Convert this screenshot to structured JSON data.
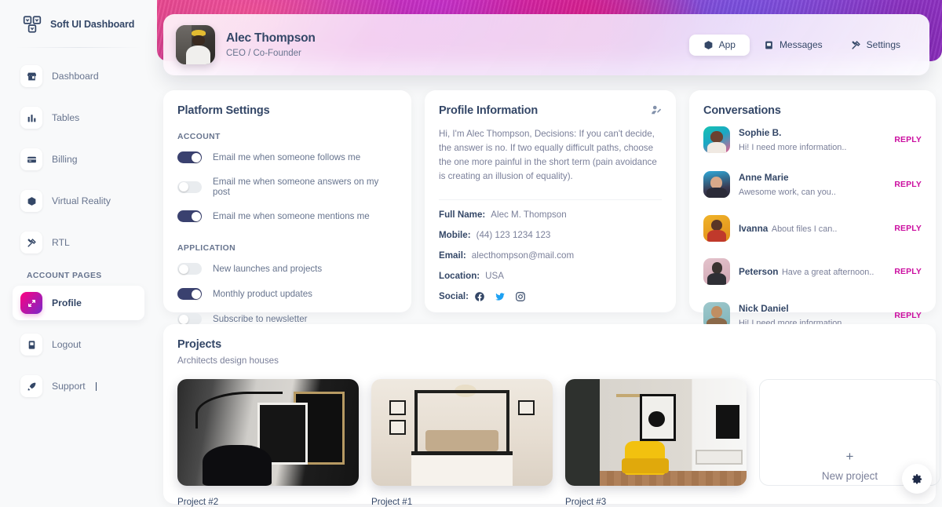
{
  "brand": {
    "name": "Soft UI Dashboard"
  },
  "sidebar": {
    "items": [
      {
        "label": "Dashboard",
        "icon": "shop-icon"
      },
      {
        "label": "Tables",
        "icon": "table-icon"
      },
      {
        "label": "Billing",
        "icon": "credit-card-icon"
      },
      {
        "label": "Virtual Reality",
        "icon": "cube-icon"
      },
      {
        "label": "RTL",
        "icon": "tools-icon"
      }
    ],
    "section_title": "ACCOUNT PAGES",
    "account_items": [
      {
        "label": "Profile",
        "icon": "profile-icon",
        "active": true
      },
      {
        "label": "Logout",
        "icon": "document-icon",
        "active": false
      },
      {
        "label": "Support",
        "icon": "rocket-icon",
        "active": false
      }
    ]
  },
  "header": {
    "user_name": "Alec Thompson",
    "user_role": "CEO / Co-Founder",
    "tabs": [
      {
        "label": "App",
        "icon": "cube-icon",
        "active": true
      },
      {
        "label": "Messages",
        "icon": "mail-icon",
        "active": false
      },
      {
        "label": "Settings",
        "icon": "tools-icon",
        "active": false
      }
    ]
  },
  "platform_settings": {
    "title": "Platform Settings",
    "account_label": "ACCOUNT",
    "application_label": "APPLICATION",
    "account_toggles": [
      {
        "label": "Email me when someone follows me",
        "on": true
      },
      {
        "label": "Email me when someone answers on my post",
        "on": false
      },
      {
        "label": "Email me when someone mentions me",
        "on": true
      }
    ],
    "application_toggles": [
      {
        "label": "New launches and projects",
        "on": false
      },
      {
        "label": "Monthly product updates",
        "on": true
      },
      {
        "label": "Subscribe to newsletter",
        "on": false
      }
    ]
  },
  "profile_information": {
    "title": "Profile Information",
    "edit_icon": "edit-profile-icon",
    "bio": "Hi, I'm Alec Thompson, Decisions: If you can't decide, the answer is no. If two equally difficult paths, choose the one more painful in the short term (pain avoidance is creating an illusion of equality).",
    "fields": [
      {
        "key": "Full Name:",
        "value": "Alec M. Thompson"
      },
      {
        "key": "Mobile:",
        "value": "(44) 123 1234 123"
      },
      {
        "key": "Email:",
        "value": "alecthompson@mail.com"
      },
      {
        "key": "Location:",
        "value": "USA"
      }
    ],
    "social_label": "Social:",
    "socials": [
      {
        "name": "facebook-icon",
        "color": "#344767"
      },
      {
        "name": "twitter-icon",
        "color": "#1da1f2"
      },
      {
        "name": "instagram-icon",
        "color": "#344767"
      }
    ]
  },
  "conversations": {
    "title": "Conversations",
    "reply_label": "REPLY",
    "items": [
      {
        "name": "Sophie B.",
        "message": "Hi! I need more information..",
        "avatar_colors": [
          "#17c3b2",
          "#e85d8f"
        ]
      },
      {
        "name": "Anne Marie",
        "message": "Awesome work, can you..",
        "avatar_colors": [
          "#2ea8d8",
          "#3a3a52"
        ]
      },
      {
        "name": "Ivanna",
        "message": "About files I can..",
        "avatar_colors": [
          "#e8a317",
          "#c0392b"
        ]
      },
      {
        "name": "Peterson",
        "message": "Have a great afternoon..",
        "avatar_colors": [
          "#d9b3bd",
          "#2f2f35"
        ]
      },
      {
        "name": "Nick Daniel",
        "message": "Hi! I need more information..",
        "avatar_colors": [
          "#7fb3b8",
          "#8c6a4a"
        ]
      }
    ]
  },
  "projects": {
    "title": "Projects",
    "subtitle": "Architects design houses",
    "items": [
      {
        "name": "Project #2",
        "art": "a1"
      },
      {
        "name": "Project #1",
        "art": "a2"
      },
      {
        "name": "Project #3",
        "art": "a3"
      }
    ],
    "new_project": {
      "plus": "+",
      "label": "New project"
    }
  },
  "fab": {
    "icon": "gear-icon"
  },
  "colors": {
    "accent_pink": "#cb0c9f",
    "accent_purple": "#7928CA",
    "accent_magenta": "#FF0080",
    "text_dark": "#344767",
    "text_muted": "#67748e",
    "toggle_on": "#3a416f",
    "background": "#f8f9fa"
  }
}
